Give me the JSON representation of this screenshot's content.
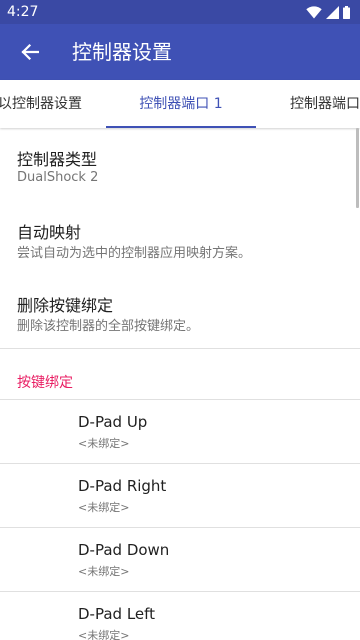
{
  "status_bar": {
    "time": "4:27"
  },
  "app_bar": {
    "title": "控制器设置"
  },
  "tabs": [
    {
      "label": "以控制器设置"
    },
    {
      "label": "控制器端口 1"
    },
    {
      "label": "控制器端口"
    }
  ],
  "preferences": [
    {
      "title": "控制器类型",
      "summary": "DualShock 2"
    },
    {
      "title": "自动映射",
      "summary": "尝试自动为选中的控制器应用映射方案。"
    },
    {
      "title": "删除按键绑定",
      "summary": "删除该控制器的全部按键绑定。"
    }
  ],
  "bindings_section": {
    "header": "按键绑定",
    "items": [
      {
        "title": "D-Pad Up",
        "summary": "<未绑定>"
      },
      {
        "title": "D-Pad Right",
        "summary": "<未绑定>"
      },
      {
        "title": "D-Pad Down",
        "summary": "<未绑定>"
      },
      {
        "title": "D-Pad Left",
        "summary": "<未绑定>"
      }
    ]
  },
  "colors": {
    "primary": "#3f51b5",
    "status_bar": "#3a49a4",
    "accent": "#e91e63"
  }
}
